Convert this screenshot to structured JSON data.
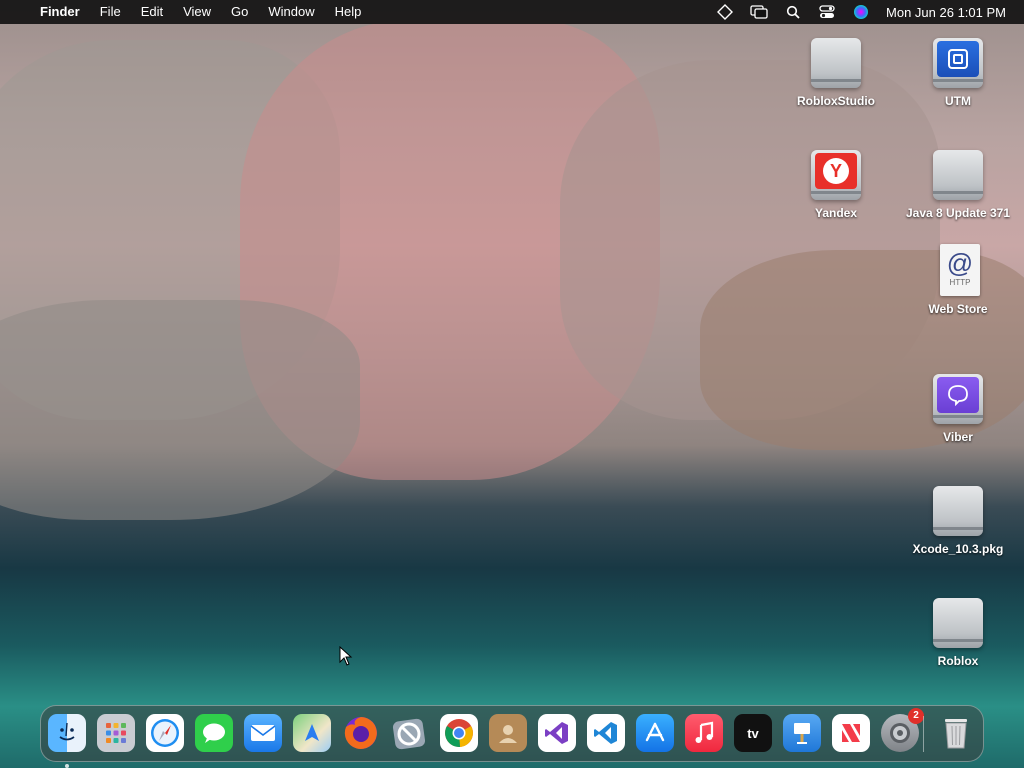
{
  "menubar": {
    "apple_glyph": "",
    "app_name": "Finder",
    "menus": [
      "File",
      "Edit",
      "View",
      "Go",
      "Window",
      "Help"
    ],
    "status_icons": [
      "display-diamond-icon",
      "screen-mirroring-icon",
      "spotlight-search-icon",
      "control-center-icon",
      "siri-icon"
    ],
    "clock": "Mon Jun 26  1:01 PM"
  },
  "desktop": {
    "icons": [
      {
        "label": "RobloxStudio",
        "icon": "drive-icon"
      },
      {
        "label": "UTM",
        "icon": "utm-icon"
      },
      {
        "label": "Yandex",
        "icon": "yandex-icon"
      },
      {
        "label": "Java 8 Update 371",
        "icon": "drive-icon"
      },
      {
        "label": "Web Store",
        "icon": "webloc-file-icon"
      },
      {
        "label": "Viber",
        "icon": "viber-icon"
      },
      {
        "label": "Xcode_10.3.pkg",
        "icon": "drive-icon"
      },
      {
        "label": "Roblox",
        "icon": "drive-icon"
      }
    ],
    "webloc_at": "@",
    "webloc_tag": "HTTP",
    "yandex_letter": "Y"
  },
  "dock": {
    "apps": [
      {
        "icon": "finder-icon",
        "color": "#2b8ff0"
      },
      {
        "icon": "launchpad-icon",
        "color": "#c9ccd2"
      },
      {
        "icon": "safari-icon",
        "color": "#1f8ef1"
      },
      {
        "icon": "messages-icon",
        "color": "#2fcf4b"
      },
      {
        "icon": "mail-icon",
        "color": "#2a8cf2"
      },
      {
        "icon": "maps-icon",
        "color": "#58b85a"
      },
      {
        "icon": "firefox-icon",
        "color": "#e8591f"
      },
      {
        "icon": "no-entry-app-icon",
        "color": "#9aa7b4"
      },
      {
        "icon": "chrome-icon",
        "color": "#ffffff"
      },
      {
        "icon": "contacts-icon",
        "color": "#b58a57"
      },
      {
        "icon": "visual-studio-icon",
        "color": "#ffffff"
      },
      {
        "icon": "vscode-icon",
        "color": "#ffffff"
      },
      {
        "icon": "app-store-icon",
        "color": "#1c8df3"
      },
      {
        "icon": "music-icon",
        "color": "#f63b4e"
      },
      {
        "icon": "apple-tv-icon",
        "color": "#111111"
      },
      {
        "icon": "keynote-icon",
        "color": "#2f8fe6"
      },
      {
        "icon": "news-icon",
        "color": "#ffffff"
      },
      {
        "icon": "system-settings-icon",
        "color": "#8e9297"
      }
    ],
    "tv_label": "tv",
    "settings_badge": "2",
    "trash_icon": "trash-icon"
  }
}
